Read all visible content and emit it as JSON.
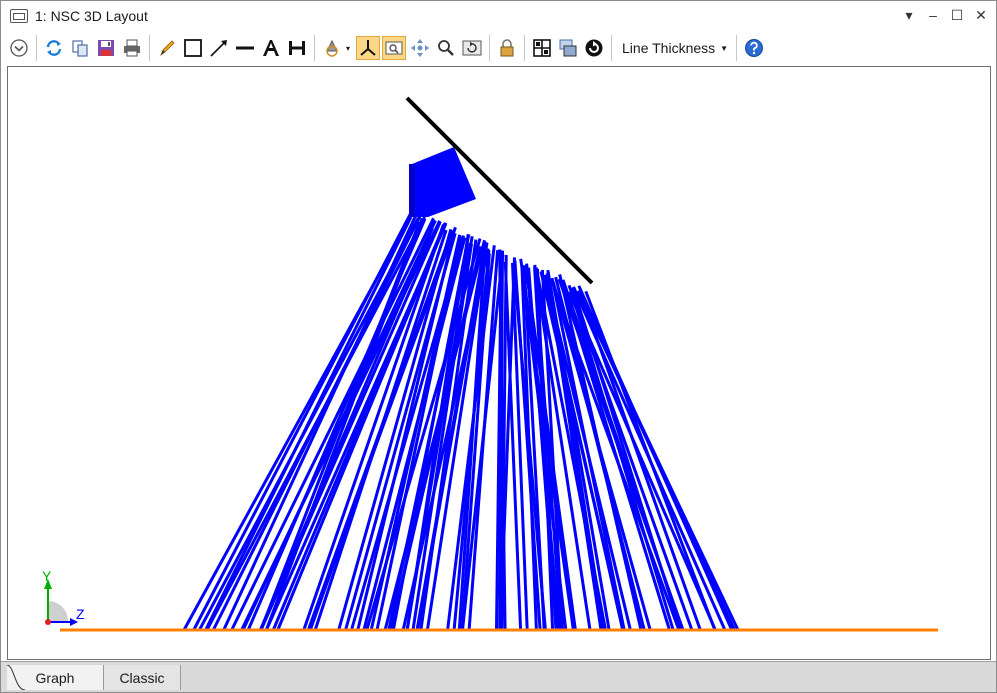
{
  "window": {
    "title": "1: NSC 3D Layout",
    "controls": [
      {
        "name": "menu-dropdown-icon",
        "glyph": "▾"
      },
      {
        "name": "minimize-icon",
        "glyph": "–"
      },
      {
        "name": "maximize-icon",
        "glyph": "☐"
      },
      {
        "name": "close-icon",
        "glyph": "✕"
      }
    ]
  },
  "toolbar": {
    "line_thickness_label": "Line Thickness",
    "icons": [
      "settings-expand",
      "refresh",
      "copy",
      "save",
      "print",
      "pencil",
      "rectangle",
      "arrow-line",
      "line",
      "text",
      "dimension",
      "rotate-3d",
      "axis-orient",
      "zoom-window",
      "pan",
      "zoom",
      "reset-view",
      "lock",
      "grid-layout",
      "window-stack",
      "automatic-update",
      "help"
    ]
  },
  "axis_triad": {
    "y_label": "Y",
    "z_label": "Z"
  },
  "colors": {
    "rays": "#0000ff",
    "detector": "#ff8000",
    "mirror": "#000000",
    "toggle_active": "#fbd786"
  },
  "tabs": [
    {
      "label": "Graph",
      "active": true
    },
    {
      "label": "Classic",
      "active": false
    }
  ]
}
